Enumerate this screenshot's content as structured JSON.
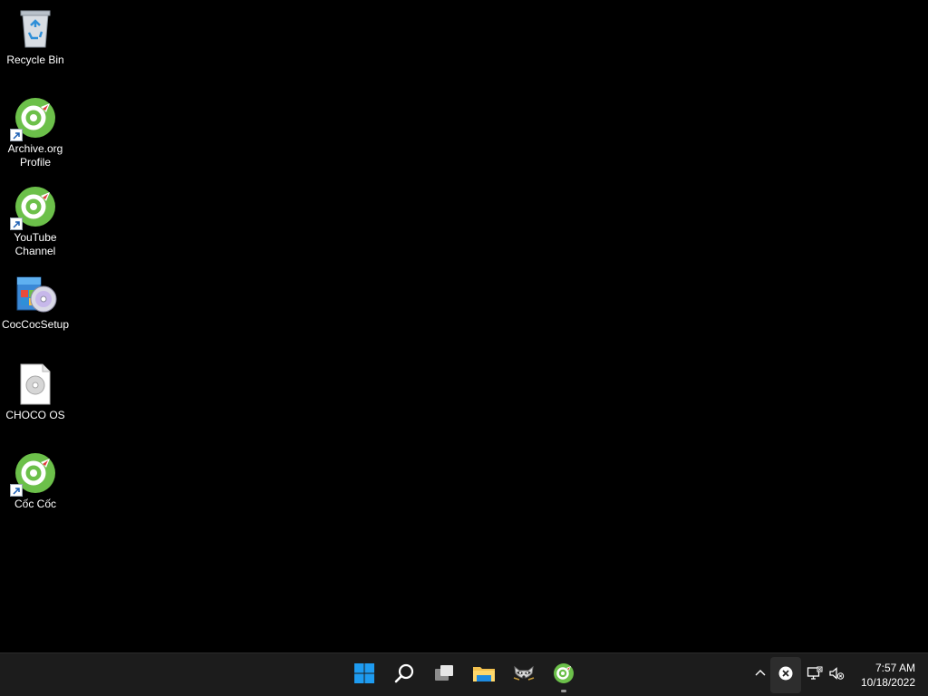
{
  "desktop": {
    "background_color": "#000000",
    "icons": [
      {
        "label": "Recycle Bin",
        "icon": "recycle-bin-icon"
      },
      {
        "label": "Archive.org\nProfile",
        "icon": "coccoc-shortcut-icon"
      },
      {
        "label": "YouTube\nChannel",
        "icon": "coccoc-shortcut-icon"
      },
      {
        "label": "CocCocSetup",
        "icon": "installer-cd-icon"
      },
      {
        "label": "CHOCO OS",
        "icon": "disc-image-file-icon"
      },
      {
        "label": "Cốc Cốc",
        "icon": "coccoc-shortcut-icon"
      }
    ]
  },
  "taskbar": {
    "background_color": "#1c1c1c",
    "apps": [
      {
        "icon": "windows-start-icon"
      },
      {
        "icon": "search-icon"
      },
      {
        "icon": "task-view-icon"
      },
      {
        "icon": "file-explorer-icon"
      },
      {
        "icon": "raccoon-app-icon"
      },
      {
        "icon": "coccoc-browser-icon"
      }
    ],
    "tray": {
      "icons": [
        "chevron-up-icon",
        "close-circle-icon",
        "network-icon",
        "volume-muted-icon"
      ]
    },
    "clock": {
      "time": "7:57 AM",
      "date": "10/18/2022"
    }
  },
  "colors": {
    "coccoc_green": "#6cc04a",
    "windows_blue": "#1e9bf0",
    "folder_yellow": "#f2c14e"
  }
}
